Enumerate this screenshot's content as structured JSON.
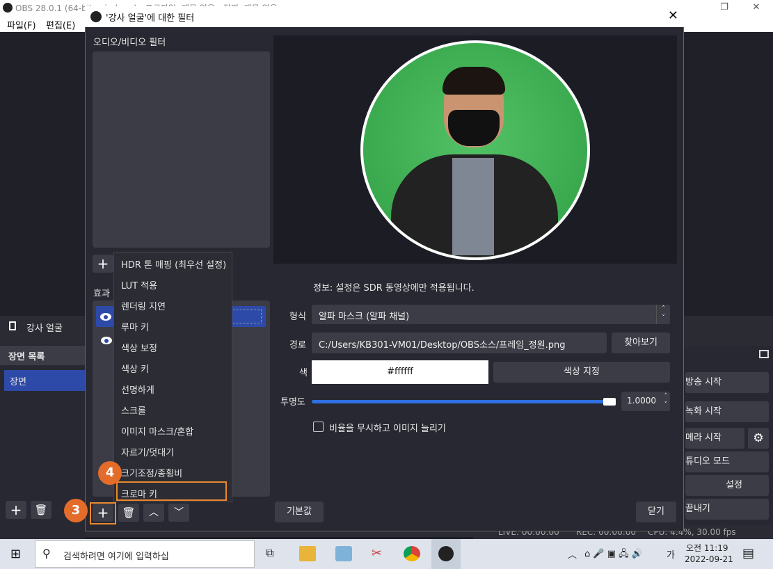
{
  "main": {
    "title": "OBS 28.0.1 (64-bit, windows) - 프로파일: 제목 없음 - 장면: 제목 없음",
    "menu": [
      "파일(F)",
      "편집(E)"
    ],
    "source_item": "강사 얼굴",
    "scene_list_header": "장면 목록",
    "scene_item": "장면",
    "controls": [
      "방송 시작",
      "녹화 시작",
      "메라 시작",
      "튜디오 모드",
      "설정",
      "끝내기"
    ],
    "status": {
      "live": "LIVE: 00:00:00",
      "rec": "REC: 00:00:00",
      "cpu": "CPU: 4.4%, 30.00 fps"
    }
  },
  "dialog": {
    "title": "'강사 얼굴'에 대한 필터",
    "av_filter_label": "오디오/비디오 필터",
    "effects_label": "효과",
    "info": "정보: 설정은 SDR 동영상에만 적용됩니다.",
    "format_label": "형식",
    "format_value": "알파 마스크 (알파 채널)",
    "path_label": "경로",
    "path_value": "C:/Users/KB301-VM01/Desktop/OBS소스/프레임_정원.png",
    "browse_button": "찾아보기",
    "color_label": "색",
    "color_value": "#ffffff",
    "color_pick_button": "색상 지정",
    "opacity_label": "투명도",
    "opacity_value": "1.0000",
    "opacity_fraction": 1.0,
    "stretch_checkbox": "비율을 무시하고 이미지 늘리기",
    "defaults_button": "기본값",
    "close_button": "닫기"
  },
  "menu_items": [
    "HDR 톤 매핑 (최우선 설정)",
    "LUT 적용",
    "렌더링 지연",
    "루마 키",
    "색상 보정",
    "색상 키",
    "선명하게",
    "스크롤",
    "이미지 마스크/혼합",
    "자르기/덧대기",
    "크기조정/종횡비",
    "크로마 키"
  ],
  "badges": [
    "3",
    "4"
  ],
  "taskbar": {
    "search_placeholder": "검색하려면 여기에 입력하십",
    "ime": "가",
    "time": "오전 11:19",
    "date": "2022-09-21"
  },
  "colors": {
    "accent": "#2e4aa8",
    "highlight": "#e8892f",
    "badge": "#e36c2a"
  }
}
